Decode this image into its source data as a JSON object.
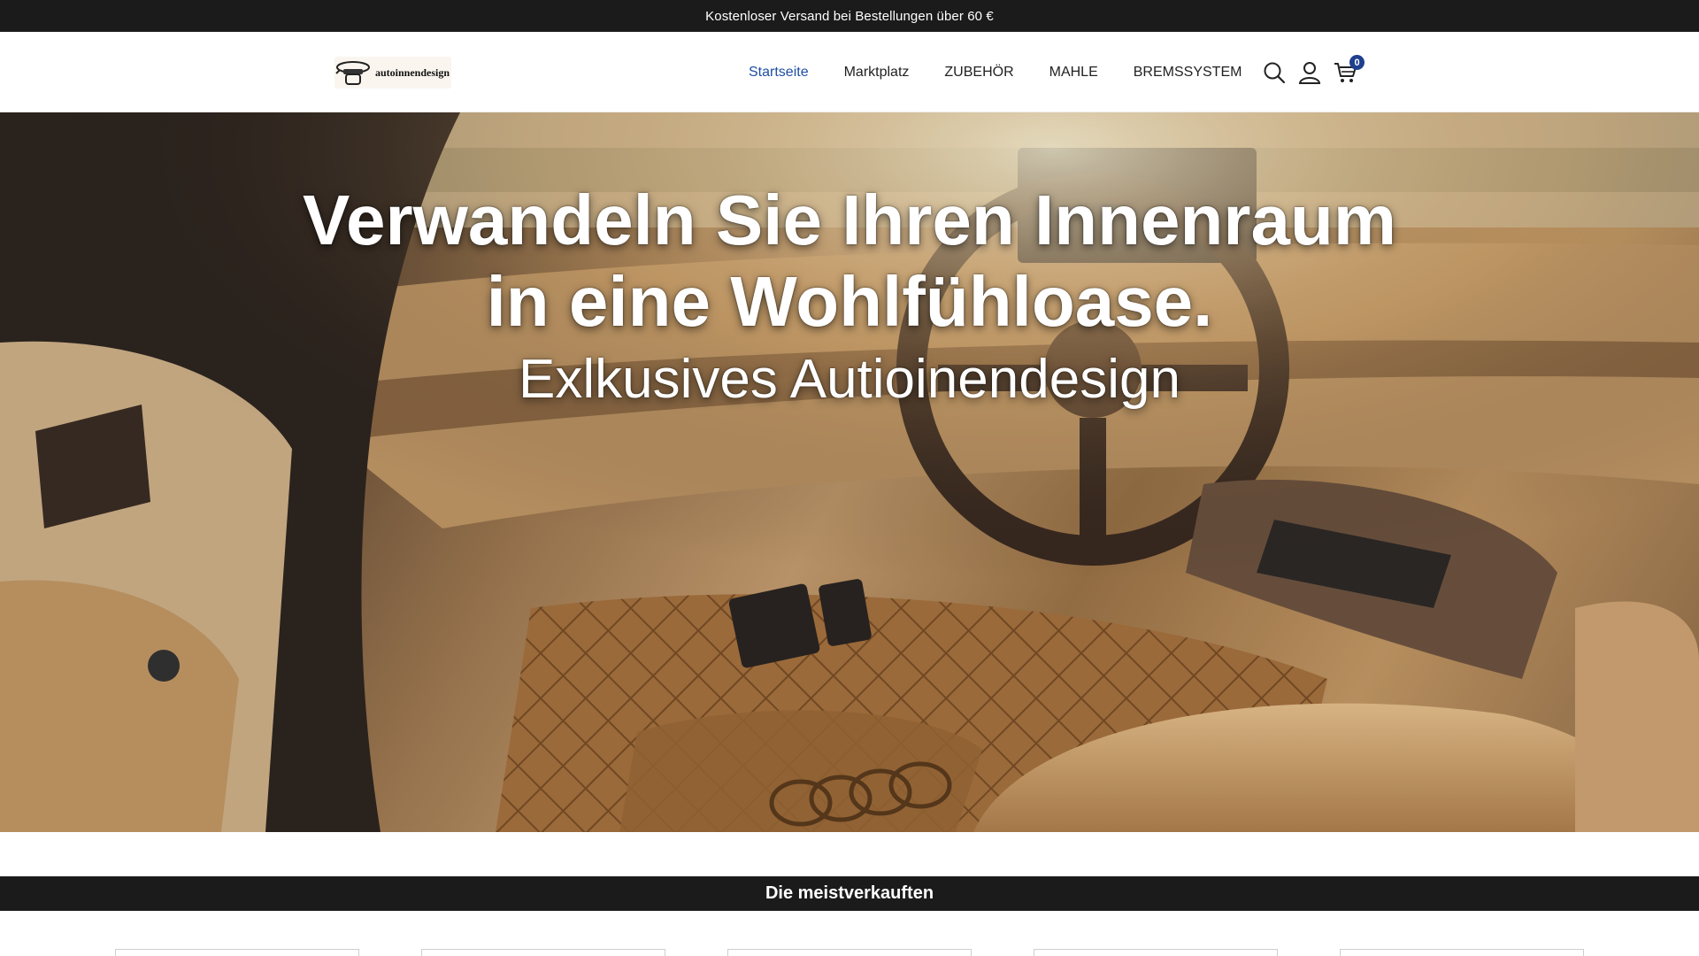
{
  "announcement": {
    "text": "Kostenloser Versand bei Bestellungen über 60 €"
  },
  "header": {
    "logo_text": "autoinnendesign",
    "nav": [
      {
        "label": "Startseite",
        "active": true
      },
      {
        "label": "Marktplatz",
        "active": false
      },
      {
        "label": "ZUBEHÖR",
        "active": false
      },
      {
        "label": "MAHLE",
        "active": false
      },
      {
        "label": "BREMSSYSTEM",
        "active": false
      }
    ],
    "icons": [
      "search-icon",
      "account-icon",
      "cart-icon"
    ],
    "cart_count": "0",
    "accent_color": "#1f4fa3"
  },
  "hero": {
    "title_line1": "Verwandeln Sie Ihren Innenraum",
    "title_line2": "in eine Wohlfühloase.",
    "subtitle": "Exlkusives Autioinendesign"
  },
  "bestsellers": {
    "heading": "Die meistverkauften",
    "product_cards": 5
  }
}
